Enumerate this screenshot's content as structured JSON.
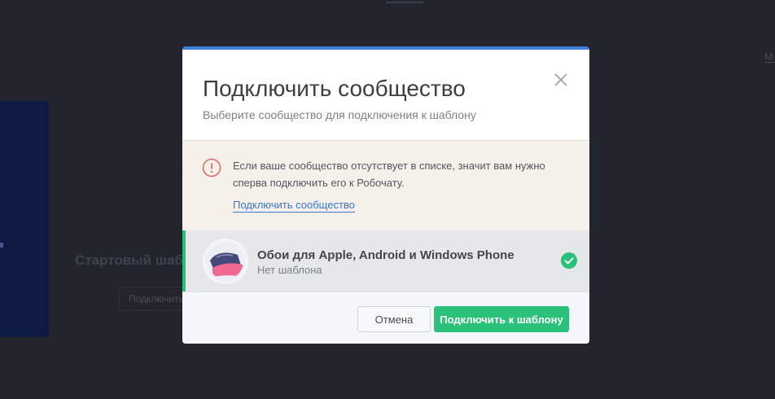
{
  "background": {
    "heading": "Стартовый шаблон",
    "button_label": "Подключить",
    "right_edge_text": "М"
  },
  "modal": {
    "title": "Подключить сообщество",
    "subtitle": "Выберите сообщество для подключения к шаблону",
    "accent_color": "#3f7fdc",
    "notice": {
      "icon": "info-circle-icon",
      "text": "Если ваше сообщество отсутствует в списке, значит вам нужно сперва подключить его к Робочату.",
      "link_label": "Подключить сообщество"
    },
    "communities": [
      {
        "name": "Обои для Apple, Android и Windows Phone",
        "status": "Нет шаблона",
        "selected": true,
        "selected_color": "#27c179"
      }
    ],
    "buttons": {
      "cancel_label": "Отмена",
      "confirm_label": "Подключить к шаблону",
      "confirm_color": "#2ac27b"
    }
  }
}
